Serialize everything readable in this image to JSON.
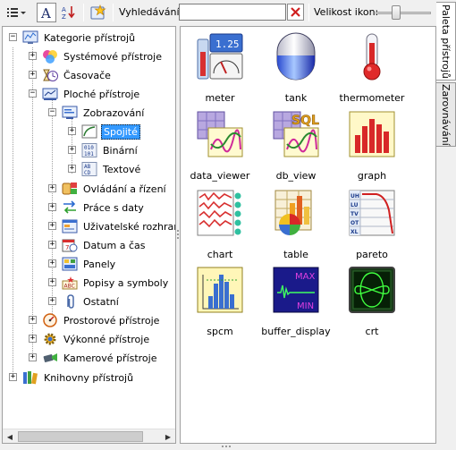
{
  "toolbar": {
    "search_label": "Vyhledávání:",
    "search_value": "",
    "icon_size_label": "Velikost ikon:",
    "icon_size_level": 0.35
  },
  "side_tabs": [
    {
      "label": "Paleta přístrojů",
      "active": true
    },
    {
      "label": "Zarovnávání",
      "active": false
    }
  ],
  "tree": {
    "root": "Kategorie přístrojů",
    "systemove": "Systémové přístroje",
    "casovace": "Časovače",
    "ploche": "Ploché přístroje",
    "zobrazovani": "Zobrazování",
    "spojite": "Spojité",
    "binarni": "Binární",
    "textove": "Textové",
    "ovladani": "Ovládání a řízení",
    "prace": "Práce s daty",
    "uzivatelske": "Uživatelské rozhraní",
    "datum": "Datum a čas",
    "panely": "Panely",
    "popisy": "Popisy a symboly",
    "ostatni": "Ostatní",
    "prostorove": "Prostorové přístroje",
    "vykonne": "Výkonné přístroje",
    "kamerove": "Kamerové přístroje",
    "knihovny": "Knihovny přístrojů",
    "selected": "Spojité"
  },
  "palette": {
    "items": [
      {
        "label": "meter",
        "icon": "meter-icon",
        "readout": "1.25"
      },
      {
        "label": "tank",
        "icon": "tank-icon"
      },
      {
        "label": "thermometer",
        "icon": "thermometer-icon"
      },
      {
        "label": "data_viewer",
        "icon": "data-viewer-icon"
      },
      {
        "label": "db_view",
        "icon": "db-view-icon",
        "badge": "SQL"
      },
      {
        "label": "graph",
        "icon": "graph-icon"
      },
      {
        "label": "chart",
        "icon": "chart-icon"
      },
      {
        "label": "table",
        "icon": "table-icon"
      },
      {
        "label": "pareto",
        "icon": "pareto-icon",
        "rows": [
          "UH",
          "LU",
          "TV",
          "OT",
          "XL"
        ]
      },
      {
        "label": "spcm",
        "icon": "spcm-icon"
      },
      {
        "label": "buffer_display",
        "icon": "buffer-display-icon",
        "max": "MAX",
        "min": "MIN"
      },
      {
        "label": "crt",
        "icon": "crt-icon"
      }
    ]
  },
  "colors": {
    "selection": "#3399ff",
    "accent_red": "#d83030",
    "icon_blue": "#3a6fd0"
  }
}
